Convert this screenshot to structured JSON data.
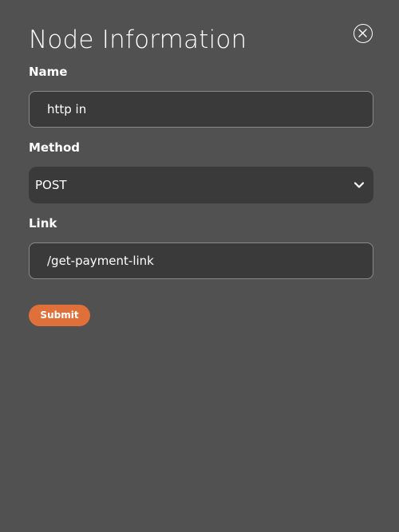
{
  "dialog": {
    "title": "Node Information",
    "close_icon": "close-circle-icon"
  },
  "fields": {
    "name": {
      "label": "Name",
      "value": "http in"
    },
    "method": {
      "label": "Method",
      "selected": "POST",
      "icon": "chevron-down-icon"
    },
    "link": {
      "label": "Link",
      "value": "/get-payment-link"
    }
  },
  "actions": {
    "submit_label": "Submit"
  },
  "colors": {
    "background": "#525152",
    "field_background": "#3a3a3a",
    "field_border": "#8a8a8a",
    "accent": "#e0703a",
    "text": "#ffffff"
  }
}
